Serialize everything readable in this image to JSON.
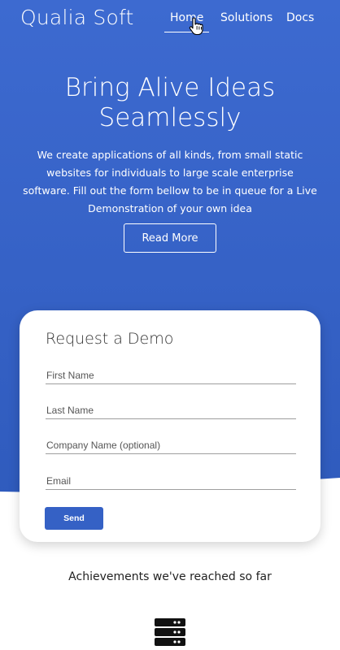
{
  "header": {
    "brand": "Qualia Soft",
    "nav": [
      {
        "label": "Home",
        "active": true
      },
      {
        "label": "Solutions"
      },
      {
        "label": "Docs"
      }
    ]
  },
  "hero": {
    "headline": "Bring Alive Ideas Seamlessly",
    "description": "We create applications of all kinds, from small static websites for individuals to large scale enterprise software. Fill out the form bellow to be in queue for a Live Demonstration of your own idea",
    "cta_label": "Read More"
  },
  "demo_form": {
    "title": "Request a Demo",
    "fields": [
      {
        "placeholder": "First Name",
        "value": ""
      },
      {
        "placeholder": "Last Name",
        "value": ""
      },
      {
        "placeholder": "Company Name (optional)",
        "value": ""
      },
      {
        "placeholder": "Email",
        "value": ""
      }
    ],
    "submit_label": "Send"
  },
  "achievements": {
    "heading": "Achievements we've reached so far",
    "icon": "server-icon"
  },
  "colors": {
    "primary": "#3561c5",
    "hero_top": "#3d6ad0",
    "text_dark": "#222222"
  }
}
